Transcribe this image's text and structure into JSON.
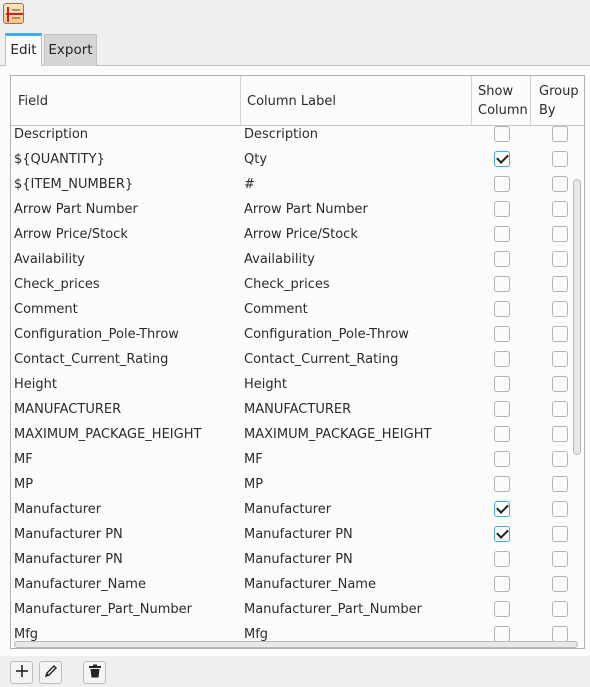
{
  "app_icon": "spreadsheet-app-icon",
  "tabs": [
    "Edit",
    "Export"
  ],
  "columns": {
    "field": "Field",
    "label": "Column Label",
    "show": "Show\nColumn",
    "group": "Group\nBy"
  },
  "rows": [
    {
      "field": "Description",
      "label": "Description",
      "show": false,
      "group": false
    },
    {
      "field": "${QUANTITY}",
      "label": "Qty",
      "show": true,
      "group": false
    },
    {
      "field": "${ITEM_NUMBER}",
      "label": "#",
      "show": false,
      "group": false
    },
    {
      "field": "Arrow Part Number",
      "label": "Arrow Part Number",
      "show": false,
      "group": false
    },
    {
      "field": "Arrow Price/Stock",
      "label": "Arrow Price/Stock",
      "show": false,
      "group": false
    },
    {
      "field": "Availability",
      "label": "Availability",
      "show": false,
      "group": false
    },
    {
      "field": "Check_prices",
      "label": "Check_prices",
      "show": false,
      "group": false
    },
    {
      "field": "Comment",
      "label": "Comment",
      "show": false,
      "group": false
    },
    {
      "field": "Configuration_Pole-Throw",
      "label": "Configuration_Pole-Throw",
      "show": false,
      "group": false
    },
    {
      "field": "Contact_Current_Rating",
      "label": "Contact_Current_Rating",
      "show": false,
      "group": false
    },
    {
      "field": "Height",
      "label": "Height",
      "show": false,
      "group": false
    },
    {
      "field": "MANUFACTURER",
      "label": "MANUFACTURER",
      "show": false,
      "group": false
    },
    {
      "field": "MAXIMUM_PACKAGE_HEIGHT",
      "label": "MAXIMUM_PACKAGE_HEIGHT",
      "show": false,
      "group": false
    },
    {
      "field": "MF",
      "label": "MF",
      "show": false,
      "group": false
    },
    {
      "field": "MP",
      "label": "MP",
      "show": false,
      "group": false
    },
    {
      "field": "Manufacturer",
      "label": "Manufacturer",
      "show": true,
      "group": false
    },
    {
      "field": "Manufacturer PN",
      "label": "Manufacturer PN",
      "show": true,
      "group": false
    },
    {
      "field": "Manufacturer PN",
      "label": "Manufacturer PN",
      "show": false,
      "group": false
    },
    {
      "field": "Manufacturer_Name",
      "label": "Manufacturer_Name",
      "show": false,
      "group": false
    },
    {
      "field": "Manufacturer_Part_Number",
      "label": "Manufacturer_Part_Number",
      "show": false,
      "group": false
    },
    {
      "field": "Mfg",
      "label": "Mfg",
      "show": false,
      "group": false
    }
  ],
  "toolbar": {
    "add_icon": "plus-icon",
    "edit_icon": "pencil-icon",
    "delete_icon": "trash-icon"
  },
  "colors": {
    "accent": "#3daee9"
  }
}
